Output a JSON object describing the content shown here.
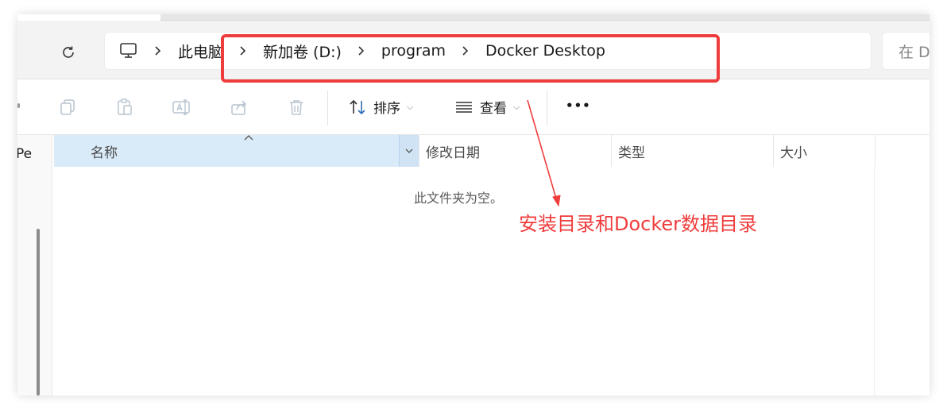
{
  "navbar": {
    "breadcrumb": [
      {
        "label": "此电脑"
      },
      {
        "label": "新加卷 (D:)"
      },
      {
        "label": "program"
      },
      {
        "label": "Docker Desktop"
      }
    ],
    "search_placeholder": "在 D"
  },
  "toolbar": {
    "sort_label": "排序",
    "view_label": "查看",
    "more_label": "•••"
  },
  "sidebar": {
    "partial_label": "Pe"
  },
  "columns": {
    "name": "名称",
    "date": "修改日期",
    "type": "类型",
    "size": "大小"
  },
  "content": {
    "empty_message": "此文件夹为空。"
  },
  "annotation": {
    "text": "安装目录和Docker数据目录",
    "color": "#ef3d3d"
  },
  "colors": {
    "header_selected": "#d9eaf8",
    "accent_blue": "#2f6fb5"
  }
}
